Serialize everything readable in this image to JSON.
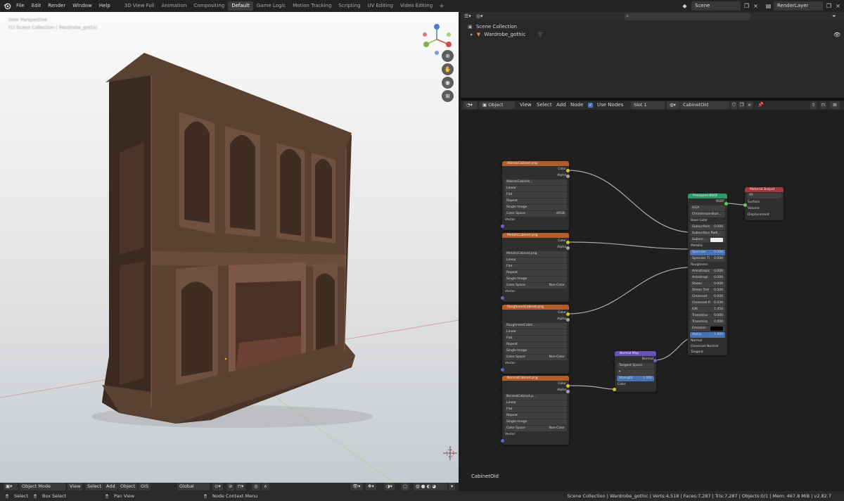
{
  "topbar": {
    "menus": [
      "File",
      "Edit",
      "Render",
      "Window",
      "Help"
    ],
    "workspaces": [
      "3D View Full",
      "Animation",
      "Compositing",
      "Default",
      "Game Logic",
      "Motion Tracking",
      "Scripting",
      "UV Editing",
      "Video Editing"
    ],
    "active_workspace": "Default",
    "scene": "Scene",
    "render_layer": "RenderLayer"
  },
  "viewport": {
    "perspective": "User Perspective",
    "collection": "(1) Scene Collection | Wardrobe_gothic",
    "gizmo_axes": [
      "X",
      "Y",
      "Z"
    ],
    "toolbar": {
      "mode": "Object Mode",
      "menus": [
        "View",
        "Select",
        "Add",
        "Object",
        "GIS"
      ],
      "transform": "Global"
    }
  },
  "outliner": {
    "root": "Scene Collection",
    "object": "Wardrobe_gothic"
  },
  "node_editor": {
    "header": {
      "type": "Object",
      "menus": [
        "View",
        "Select",
        "Add",
        "Node"
      ],
      "use_nodes": "Use Nodes",
      "slot": "Slot 1",
      "material": "CabinetOld"
    },
    "title": "CabinetOld",
    "texture_nodes": [
      {
        "title": "AlbedoCabinet.png",
        "image": "AlbedoCabinet...",
        "color_space": "sRGB"
      },
      {
        "title": "MetalicCabinet.png",
        "image": "MetalicCabinet.png",
        "color_space": "Non-Color"
      },
      {
        "title": "RoughnessCabinet.png",
        "image": "RoughnessCabin...",
        "color_space": "Non-Color"
      },
      {
        "title": "NormalCabinet.png",
        "image": "NormalCabinet.p...",
        "color_space": "Non-Color"
      }
    ],
    "texture_labels": {
      "color": "Color",
      "alpha": "Alpha",
      "interp": "Linear",
      "proj": "Flat",
      "ext": "Repeat",
      "source": "Single Image",
      "cs_label": "Color Space",
      "vector": "Vector"
    },
    "principled": {
      "title": "Principled BSDF",
      "out": "BSDF",
      "dist": "GGX",
      "sss_method": "Christensen-Burl...",
      "rows": [
        {
          "label": "Base Color",
          "value": ""
        },
        {
          "label": "Subsurface",
          "value": "0.000"
        },
        {
          "label": "Subsurface Radi...",
          "value": ""
        },
        {
          "label": "Subsur...",
          "value": ""
        },
        {
          "label": "Metallic",
          "value": ""
        },
        {
          "label": "Specular",
          "value": "0.500"
        },
        {
          "label": "Specular Ti",
          "value": "0.000"
        },
        {
          "label": "Roughness",
          "value": ""
        },
        {
          "label": "Anisotropic",
          "value": "0.000"
        },
        {
          "label": "Anisotropi",
          "value": "0.000"
        },
        {
          "label": "Sheen",
          "value": "0.000"
        },
        {
          "label": "Sheen Tint",
          "value": "0.500"
        },
        {
          "label": "Clearcoat",
          "value": "0.000"
        },
        {
          "label": "Clearcoat R",
          "value": "0.030"
        },
        {
          "label": "IOR",
          "value": "1.450"
        },
        {
          "label": "Transmiss",
          "value": "0.000"
        },
        {
          "label": "Transmiss",
          "value": "0.000"
        },
        {
          "label": "Emission",
          "value": ""
        },
        {
          "label": "Alpha",
          "value": "1.000"
        },
        {
          "label": "Normal",
          "value": ""
        },
        {
          "label": "Clearcoat Normal",
          "value": ""
        },
        {
          "label": "Tangent",
          "value": ""
        }
      ]
    },
    "material_output": {
      "title": "Material Output",
      "target": "All",
      "inputs": [
        "Surface",
        "Volume",
        "Displacement"
      ]
    },
    "normal_map": {
      "title": "Normal Map",
      "out": "Normal",
      "space": "Tangent Space",
      "strength_label": "Strength",
      "strength": "1.000",
      "color": "Color"
    }
  },
  "status_bar": {
    "hints": [
      "Select",
      "Box Select",
      "Pan View",
      "Node Context Menu"
    ],
    "stats": "Scene Collection | Wardrobe_gothic | Verts:4,518 | Faces:7,287 | Tris:7,287 | Objects:0/1 | Mem: 467.8 MiB | v2.82.7"
  },
  "colors": {
    "texture_header": "#b35e2a",
    "shader_header": "#2e9a6b",
    "output_header": "#a8343d",
    "vector_header": "#6a52b5",
    "wire": "#a8a8a8",
    "accent": "#4772b3"
  },
  "icons": [
    "blender-icon",
    "search-icon",
    "eye-icon",
    "zoom-icon",
    "hand-icon",
    "camera-icon",
    "grid-icon",
    "pin-icon"
  ]
}
